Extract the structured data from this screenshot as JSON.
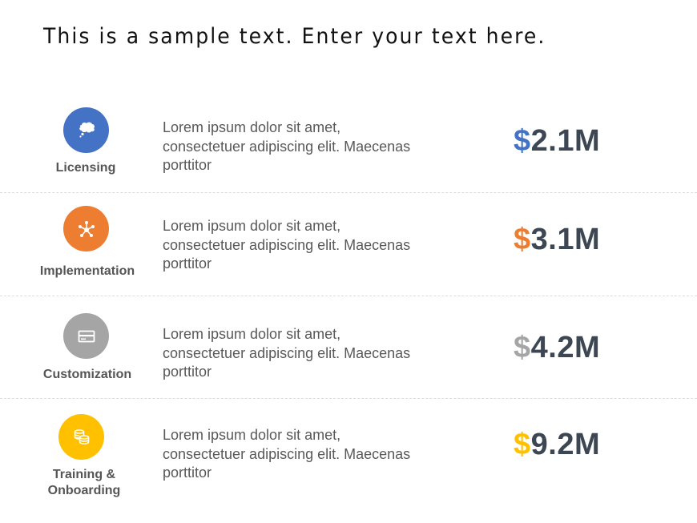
{
  "header": {
    "title": "This is a sample text. Enter your text here."
  },
  "rows": [
    {
      "label": "Licensing",
      "icon": "thought-bubble-icon",
      "color": "#4472c4",
      "description_lines": [
        "Lorem ipsum dolor sit amet,",
        "consectetuer adipiscing elit. Maecenas",
        "porttitor"
      ],
      "currency": "$",
      "value": "2.1M"
    },
    {
      "label": "Implementation",
      "icon": "network-hub-icon",
      "color": "#ed7d31",
      "description_lines": [
        "Lorem ipsum dolor sit amet,",
        "consectetuer adipiscing elit. Maecenas",
        "porttitor"
      ],
      "currency": "$",
      "value": "3.1M"
    },
    {
      "label": "Customization",
      "icon": "card-icon",
      "color": "#a5a5a5",
      "description_lines": [
        "Lorem ipsum dolor sit amet,",
        "consectetuer adipiscing elit. Maecenas",
        "porttitor"
      ],
      "currency": "$",
      "value": "4.2M"
    },
    {
      "label_lines": [
        "Training &",
        "Onboarding"
      ],
      "icon": "coins-icon",
      "color": "#ffc000",
      "description_lines": [
        "Lorem ipsum dolor sit amet,",
        "consectetuer adipiscing elit. Maecenas",
        "porttitor"
      ],
      "currency": "$",
      "value": "9.2M"
    }
  ]
}
